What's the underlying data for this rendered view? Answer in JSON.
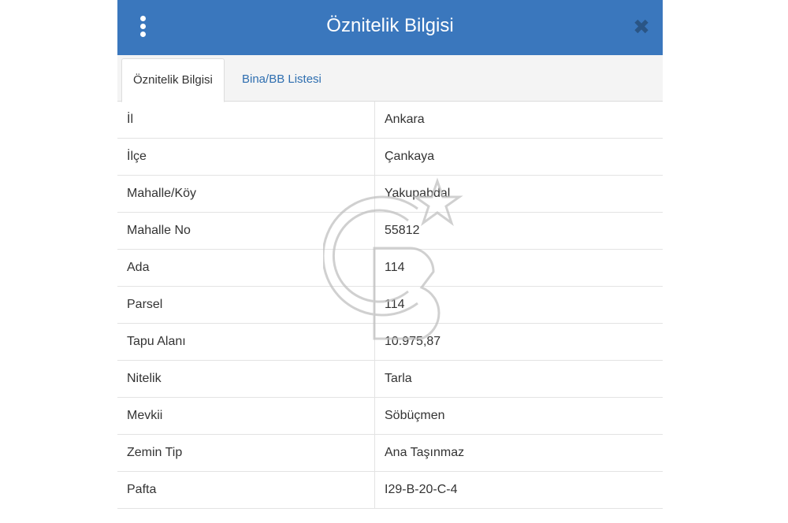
{
  "header": {
    "title": "Öznitelik Bilgisi",
    "menu_icon": "kebab-menu-icon",
    "close_icon": "close-icon",
    "close_glyph": "✖"
  },
  "tabs": [
    {
      "label": "Öznitelik Bilgisi",
      "active": true
    },
    {
      "label": "Bina/BB Listesi",
      "active": false
    }
  ],
  "rows": [
    {
      "key": "İl",
      "value": "Ankara"
    },
    {
      "key": "İlçe",
      "value": "Çankaya"
    },
    {
      "key": "Mahalle/Köy",
      "value": "Yakupabdal"
    },
    {
      "key": "Mahalle No",
      "value": "55812"
    },
    {
      "key": "Ada",
      "value": "114"
    },
    {
      "key": "Parsel",
      "value": "114"
    },
    {
      "key": "Tapu Alanı",
      "value": "10.975,87"
    },
    {
      "key": "Nitelik",
      "value": "Tarla"
    },
    {
      "key": "Mevkii",
      "value": "Söbüçmen"
    },
    {
      "key": "Zemin Tip",
      "value": "Ana Taşınmaz"
    },
    {
      "key": "Pafta",
      "value": "I29-B-20-C-4"
    }
  ],
  "colors": {
    "header": "#3a77bd",
    "tab_link": "#2f6fb0"
  }
}
